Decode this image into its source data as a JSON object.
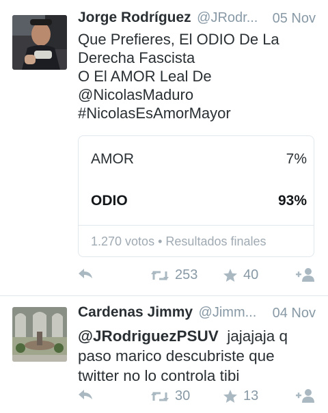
{
  "tweets": [
    {
      "name": "Jorge Rodríguez",
      "handle": "@JRodr...",
      "date": "05 Nov",
      "text_lines": [
        "Que Prefieres, El ODIO De La",
        "Derecha Fascista",
        "O El AMOR Leal De",
        "@NicolasMaduro",
        "#NicolasEsAmorMayor"
      ],
      "poll": {
        "options": [
          {
            "label": "AMOR",
            "percent": "7%"
          },
          {
            "label": "ODIO",
            "percent": "93%"
          }
        ],
        "votes": "1.270 votos",
        "separator": "•",
        "status": "Resultados finales"
      },
      "retweets": "253",
      "likes": "40"
    },
    {
      "name": "Cardenas Jimmy",
      "handle": "@Jimm...",
      "date": "04 Nov",
      "mention": "@JRodriguezPSUV",
      "text_first_rest": "jajajaja q",
      "text_lines": [
        "paso marico descubriste que",
        "twitter no lo controla tibi"
      ],
      "retweets": "30",
      "likes": "13"
    }
  ],
  "icons": {
    "reply": "reply-icon",
    "retweet": "retweet-icon",
    "like": "star-icon",
    "follow": "follow-icon"
  },
  "colors": {
    "text": "#292f33",
    "muted": "#8899a6",
    "icon": "#aab8c2",
    "border": "#e1e8ed"
  }
}
